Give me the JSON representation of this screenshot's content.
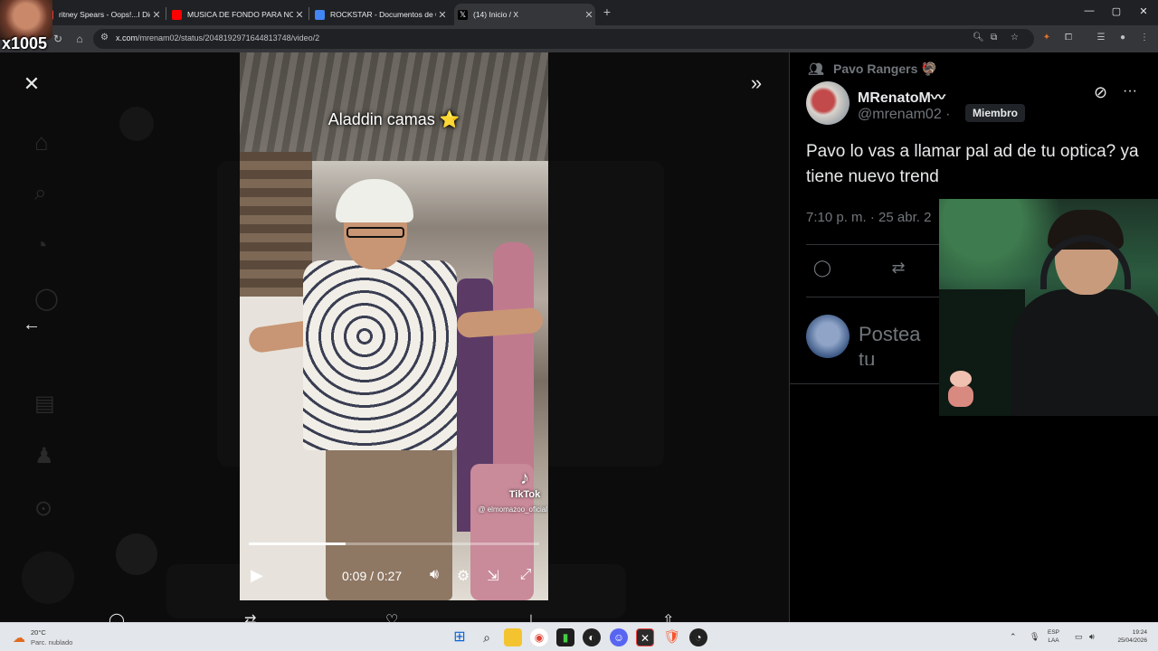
{
  "browser": {
    "tabs": [
      {
        "label": "ritney Spears - Oops!...I Did It",
        "favicon_color": "#e53935"
      },
      {
        "label": "MUSICA DE FONDO PARA NOT",
        "favicon_color": "#ff0000"
      },
      {
        "label": "ROCKSTAR - Documentos de G",
        "favicon_color": "#4285f4"
      },
      {
        "label": "(14) Inicio / X",
        "favicon_color": "#ffffff"
      }
    ],
    "tab_close": "✕",
    "new_tab": "+",
    "url_domain": "x.com",
    "url_path": "/mrenam02/status/2048192971644813748/video/2",
    "window_controls": {
      "minimize": "—",
      "maximize": "▢",
      "close": "✕"
    }
  },
  "streamer": {
    "name": "x1005"
  },
  "viewer": {
    "close_icon": "✕",
    "back_icon": "←",
    "expand_icon": "»",
    "video": {
      "caption": "Aladdin camas ⭐",
      "tiktok_icon": "♪",
      "tiktok_label": "TikTok",
      "tiktok_handle": "@ elmomazoo_oficial",
      "progress": 0.333,
      "current_time": "0:09",
      "duration": "0:27",
      "time_display": "0:09 / 0:27"
    }
  },
  "tweet": {
    "community": "Pavo Rangers 🦃",
    "display_name": "MRenatoM〰",
    "handle": "@mrenam02 ·",
    "badge": "Miembro",
    "text": "Pavo lo vas a llamar pal ad de tu optica? ya tiene nuevo trend",
    "timestamp": "7:10 p. m. · 25 abr. 2",
    "reply_placeholder": "Postea tu respuesta"
  },
  "taskbar": {
    "weather_temp": "20°C",
    "weather_desc": "Parc. nublado",
    "lang_line1": "ESP",
    "lang_line2": "LAA",
    "time": "19:24",
    "date": "25/04/2026"
  },
  "colors": {
    "x_background": "#000000",
    "x_border": "#2f3336",
    "x_secondary_text": "#71767b",
    "chrome_dark": "#202124",
    "chrome_toolbar": "#35363a",
    "taskbar": "#e3e6ea"
  }
}
